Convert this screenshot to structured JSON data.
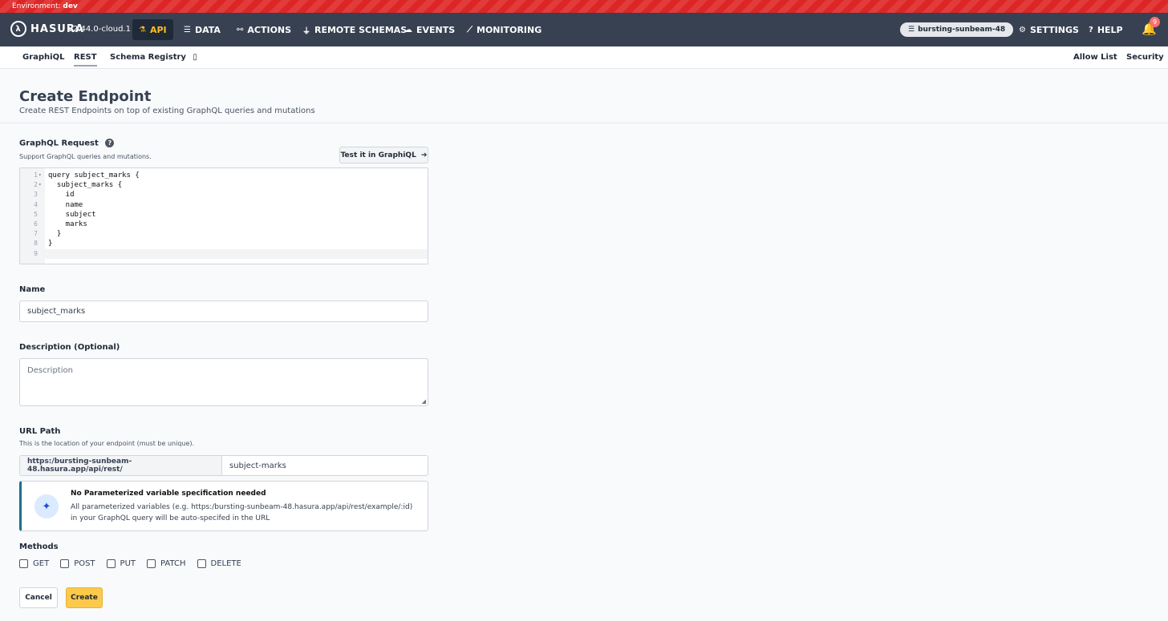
{
  "environment": {
    "label": "Environment:",
    "value": "dev"
  },
  "header": {
    "brand": "HASURA",
    "version": "v2.44.0-cloud.1",
    "nav": [
      {
        "label": "API",
        "icon": "flask-icon",
        "glyph": "⚗"
      },
      {
        "label": "DATA",
        "icon": "database-icon",
        "glyph": "☰"
      },
      {
        "label": "ACTIONS",
        "icon": "actions-icon",
        "glyph": "⚯"
      },
      {
        "label": "REMOTE SCHEMAS",
        "icon": "plug-icon",
        "glyph": "⏚"
      },
      {
        "label": "EVENTS",
        "icon": "cloud-icon",
        "glyph": "☁"
      },
      {
        "label": "MONITORING",
        "icon": "chart-icon",
        "glyph": "⟋"
      }
    ],
    "project": "bursting-sunbeam-48",
    "settings": "SETTINGS",
    "help": "HELP",
    "notification_count": "9",
    "active_color": "#fbbf24"
  },
  "subnav": {
    "left": [
      "GraphiQL",
      "REST",
      "Schema Registry"
    ],
    "right": [
      "Allow List",
      "Security"
    ]
  },
  "page": {
    "title": "Create Endpoint",
    "subtitle": "Create REST Endpoints on top of existing GraphQL queries and mutations"
  },
  "graphql": {
    "label": "GraphQL Request",
    "hint": "Support GraphQL queries and mutations.",
    "test_button": "Test it in GraphiQL",
    "code_lines": [
      {
        "n": "1",
        "text": "query subject_marks {",
        "fold": "▾"
      },
      {
        "n": "2",
        "text": "  subject_marks {",
        "fold": "▾"
      },
      {
        "n": "3",
        "text": "    id",
        "fold": ""
      },
      {
        "n": "4",
        "text": "    name",
        "fold": ""
      },
      {
        "n": "5",
        "text": "    subject",
        "fold": ""
      },
      {
        "n": "6",
        "text": "    marks",
        "fold": ""
      },
      {
        "n": "7",
        "text": "  }",
        "fold": ""
      },
      {
        "n": "8",
        "text": "}",
        "fold": ""
      },
      {
        "n": "9",
        "text": "",
        "fold": ""
      }
    ]
  },
  "name_field": {
    "label": "Name",
    "value": "subject_marks"
  },
  "description_field": {
    "label": "Description (Optional)",
    "placeholder": "Description"
  },
  "url_path": {
    "label": "URL Path",
    "hint": "This is the location of your endpoint (must be unique).",
    "prefix": "https:/bursting-sunbeam-48.hasura.app/api/rest/",
    "value": "subject-marks"
  },
  "notice": {
    "title": "No Parameterized variable specification needed",
    "text": "All parameterized variables (e.g. https:/bursting-sunbeam-48.hasura.app/api/rest/example/:id) in your GraphQL query will be auto-specifed in the URL",
    "icon": "magic-wand-icon"
  },
  "methods": {
    "label": "Methods",
    "options": [
      "GET",
      "POST",
      "PUT",
      "PATCH",
      "DELETE"
    ]
  },
  "actions": {
    "cancel": "Cancel",
    "create": "Create"
  }
}
